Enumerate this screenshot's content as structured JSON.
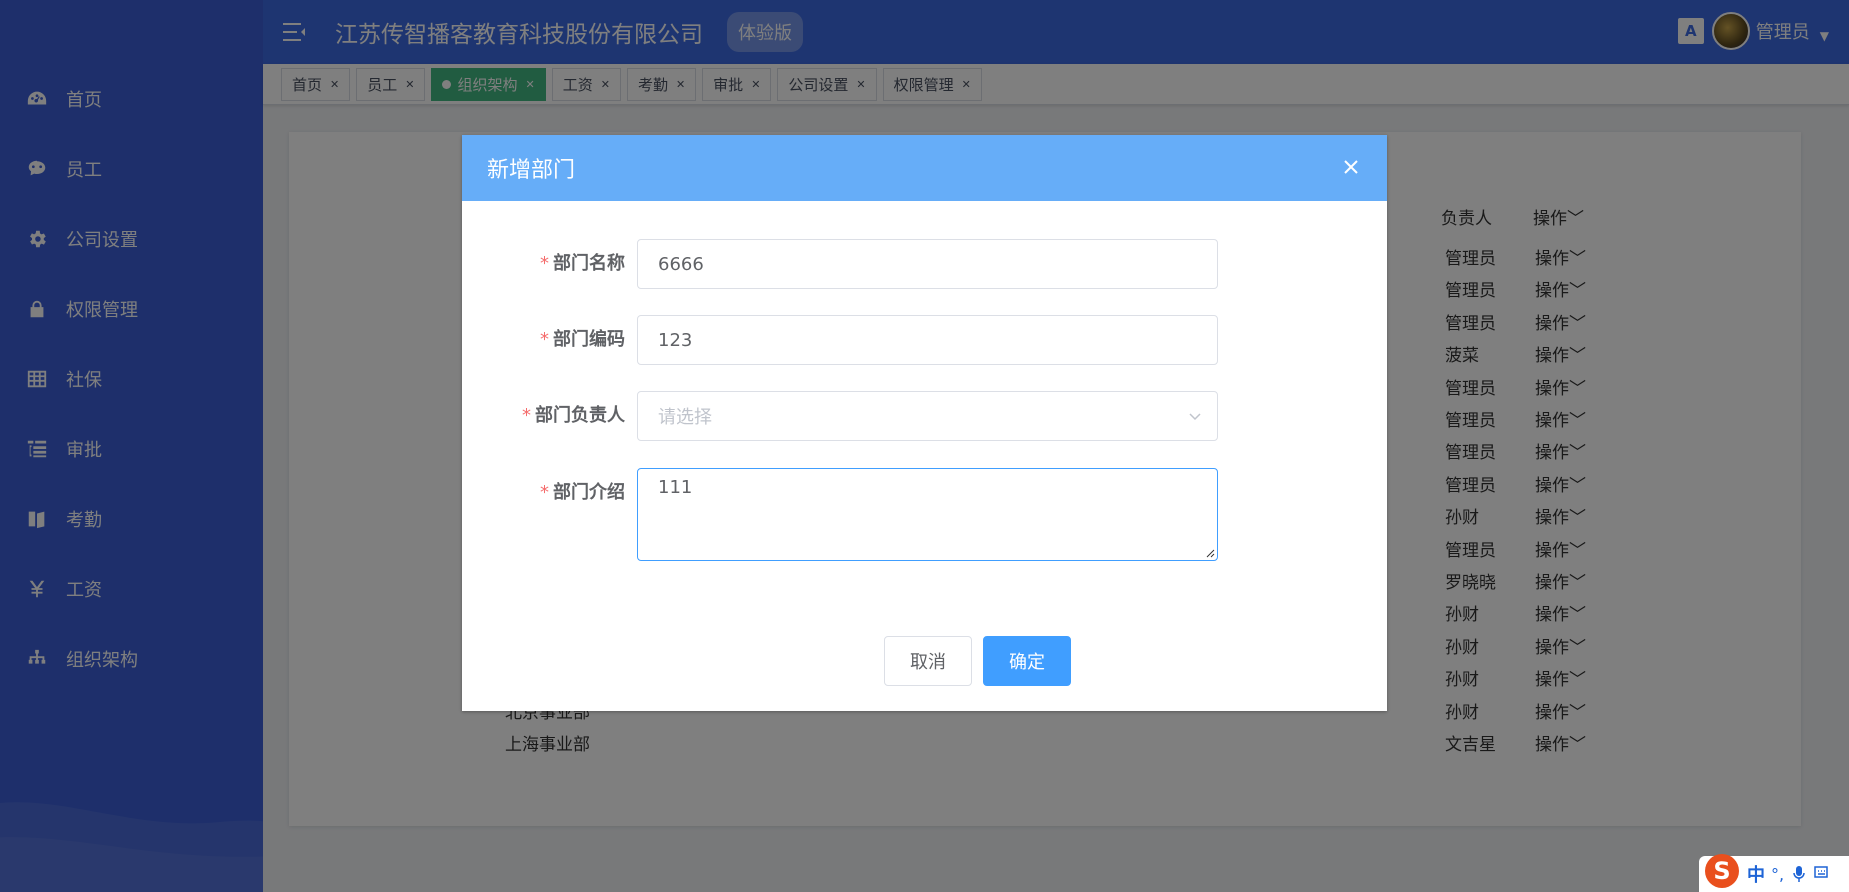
{
  "header": {
    "company_name": "江苏传智播客教育科技股份有限公司",
    "version_badge": "体验版",
    "user_name": "管理员"
  },
  "sidebar": {
    "items": [
      {
        "label": "首页",
        "icon": "dashboard-icon"
      },
      {
        "label": "员工",
        "icon": "people-icon"
      },
      {
        "label": "公司设置",
        "icon": "gear-icon"
      },
      {
        "label": "权限管理",
        "icon": "lock-icon"
      },
      {
        "label": "社保",
        "icon": "table-icon"
      },
      {
        "label": "审批",
        "icon": "tree-table-icon"
      },
      {
        "label": "考勤",
        "icon": "book-icon"
      },
      {
        "label": "工资",
        "icon": "yen-icon"
      },
      {
        "label": "组织架构",
        "icon": "org-tree-icon"
      }
    ]
  },
  "tags": [
    {
      "label": "首页",
      "active": false
    },
    {
      "label": "员工",
      "active": false
    },
    {
      "label": "组织架构",
      "active": true
    },
    {
      "label": "工资",
      "active": false
    },
    {
      "label": "考勤",
      "active": false
    },
    {
      "label": "审批",
      "active": false
    },
    {
      "label": "公司设置",
      "active": false
    },
    {
      "label": "权限管理",
      "active": false
    }
  ],
  "table": {
    "leader_header": "负责人",
    "op_header": "操作",
    "rows": [
      {
        "dept": "",
        "leader": "管理员",
        "op": "操作"
      },
      {
        "dept": "",
        "leader": "管理员",
        "op": "操作"
      },
      {
        "dept": "",
        "leader": "管理员",
        "op": "操作"
      },
      {
        "dept": "",
        "leader": "菠菜",
        "op": "操作"
      },
      {
        "dept": "",
        "leader": "管理员",
        "op": "操作"
      },
      {
        "dept": "",
        "leader": "管理员",
        "op": "操作"
      },
      {
        "dept": "",
        "leader": "管理员",
        "op": "操作"
      },
      {
        "dept": "",
        "leader": "管理员",
        "op": "操作"
      },
      {
        "dept": "",
        "leader": "孙财",
        "op": "操作"
      },
      {
        "dept": "",
        "leader": "管理员",
        "op": "操作"
      },
      {
        "dept": "",
        "leader": "罗晓晓",
        "op": "操作"
      },
      {
        "dept": "",
        "leader": "孙财",
        "op": "操作"
      },
      {
        "dept": "",
        "leader": "孙财",
        "op": "操作"
      },
      {
        "dept": "",
        "leader": "孙财",
        "op": "操作"
      },
      {
        "dept": "北京事业部",
        "leader": "孙财",
        "op": "操作"
      },
      {
        "dept": "上海事业部",
        "leader": "文吉星",
        "op": "操作"
      }
    ]
  },
  "dialog": {
    "title": "新增部门",
    "fields": {
      "name": {
        "label": "部门名称",
        "value": "6666"
      },
      "code": {
        "label": "部门编码",
        "value": "123"
      },
      "manager": {
        "label": "部门负责人",
        "placeholder": "请选择"
      },
      "intro": {
        "label": "部门介绍",
        "value": "111"
      }
    },
    "cancel_label": "取消",
    "ok_label": "确定"
  },
  "ime": {
    "logo": "S",
    "mode": "中",
    "punct": "°,"
  },
  "colors": {
    "sidebar_bg": "#3c5fd6",
    "header_bg": "#3d6ae2",
    "dialog_header_bg": "#66adf8",
    "primary": "#409eff",
    "active_tag": "#42b983"
  }
}
